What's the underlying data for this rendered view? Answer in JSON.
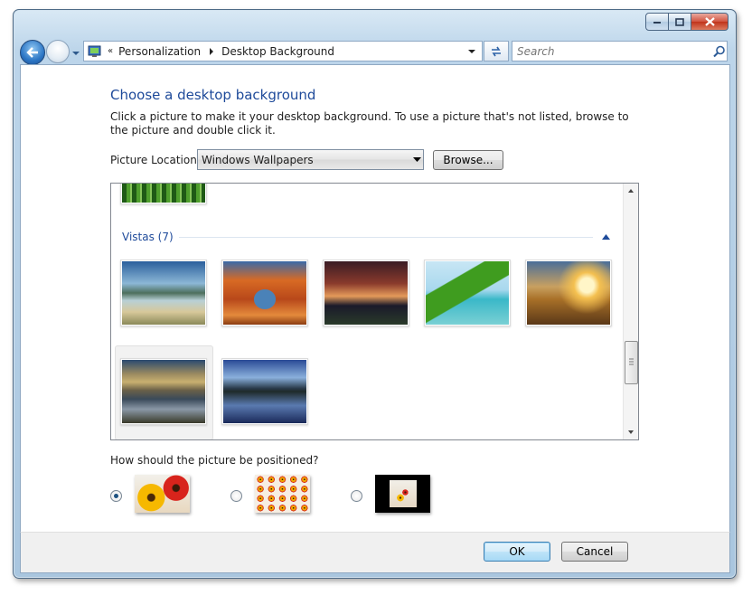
{
  "window": {
    "breadcrumb": [
      "Personalization",
      "Desktop Background"
    ],
    "search_placeholder": "Search"
  },
  "main": {
    "title": "Choose a desktop background",
    "description": "Click a picture to make it your desktop background. To use a picture that's not listed, browse to the picture and double click it.",
    "picture_location_label": "Picture Location",
    "picture_location_value": "Windows Wallpapers",
    "browse_label": "Browse...",
    "group_header": "Vistas (7)",
    "thumbnails": [
      {
        "name": "river-valley",
        "selected": false
      },
      {
        "name": "rock-arch",
        "selected": false
      },
      {
        "name": "dusk-city",
        "selected": false
      },
      {
        "name": "palm-frond",
        "selected": false
      },
      {
        "name": "sunset-grass",
        "selected": false
      },
      {
        "name": "mountain-lake-reflection",
        "selected": true
      },
      {
        "name": "peak-reflection",
        "selected": false
      }
    ],
    "position_question": "How should the picture be positioned?",
    "position_options": [
      {
        "name": "fit-to-screen",
        "checked": true
      },
      {
        "name": "tile",
        "checked": false
      },
      {
        "name": "center",
        "checked": false
      }
    ]
  },
  "footer": {
    "ok_label": "OK",
    "cancel_label": "Cancel"
  }
}
